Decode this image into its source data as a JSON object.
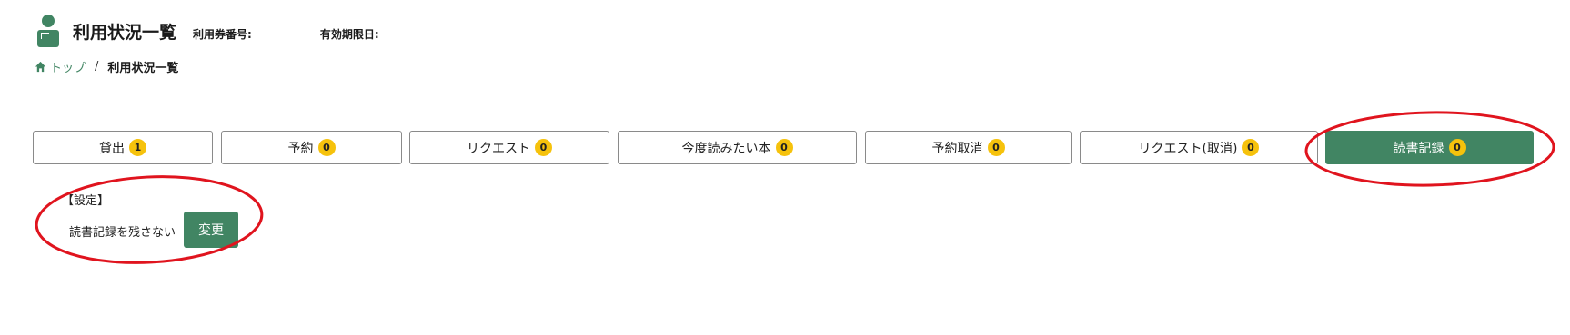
{
  "header": {
    "title": "利用状況一覧",
    "card_number_label": "利用券番号:",
    "expiry_label": "有効期限日:"
  },
  "breadcrumb": {
    "top": "トップ",
    "separator": "/",
    "current": "利用状況一覧"
  },
  "tabs": [
    {
      "label": "貸出",
      "count": "1"
    },
    {
      "label": "予約",
      "count": "0"
    },
    {
      "label": "リクエスト",
      "count": "0"
    },
    {
      "label": "今度読みたい本",
      "count": "0"
    },
    {
      "label": "予約取消",
      "count": "0"
    },
    {
      "label": "リクエスト(取消)",
      "count": "0"
    },
    {
      "label": "読書記録",
      "count": "0",
      "active": true
    }
  ],
  "settings": {
    "title": "【設定】",
    "value": "読書記録を残さない",
    "button": "変更"
  },
  "colors": {
    "accent": "#418563",
    "badge": "#f6c20c",
    "annotation": "#e0141e"
  }
}
